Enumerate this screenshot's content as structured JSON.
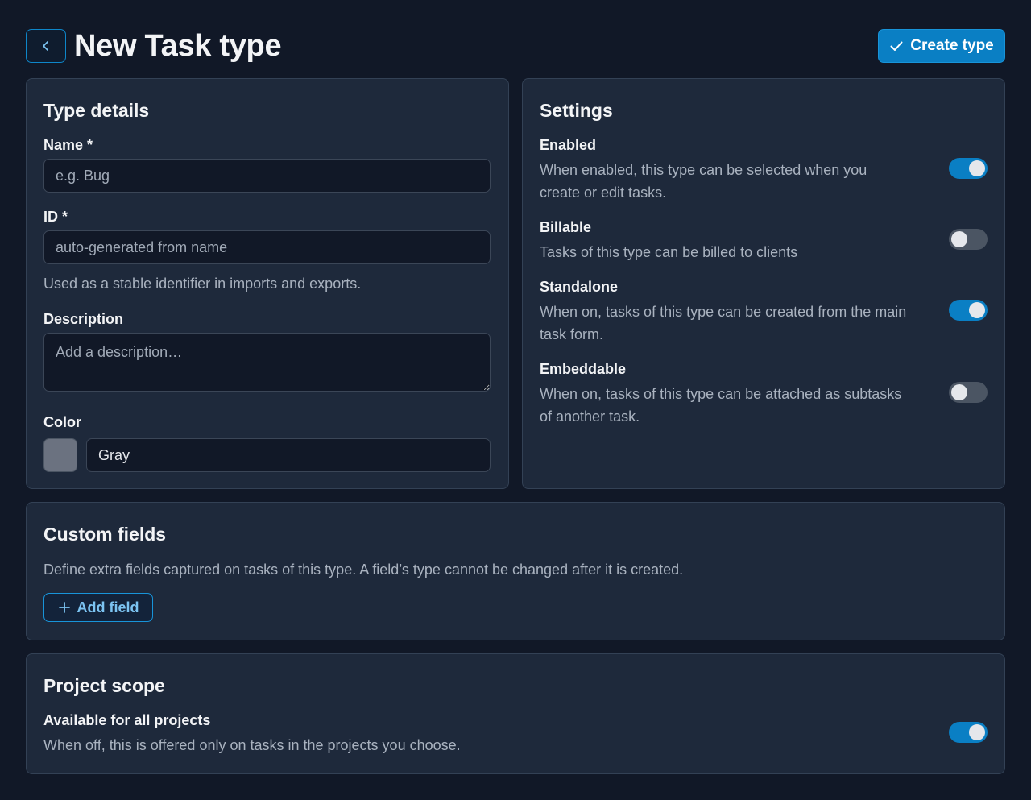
{
  "header": {
    "title": "New Task type",
    "create_label": "Create type"
  },
  "type_details": {
    "title": "Type details",
    "name_label": "Name *",
    "name_placeholder": "e.g. Bug",
    "id_label": "ID *",
    "id_placeholder": "auto-generated from name",
    "id_help": "Used as a stable identifier in imports and exports.",
    "description_label": "Description",
    "description_placeholder": "Add a description…",
    "color_label": "Color",
    "color_value": "Gray",
    "color_swatch": "#6b7280"
  },
  "settings": {
    "title": "Settings",
    "items": [
      {
        "label": "Enabled",
        "line1": "When enabled, this type can be selected when you",
        "line2": "create or edit tasks.",
        "on": true
      },
      {
        "label": "Billable",
        "line1": "Tasks of this type can be billed to clients",
        "line2": "",
        "on": false
      },
      {
        "label": "Standalone",
        "line1": "When on, tasks of this type can be created from the main",
        "line2": "task form.",
        "on": true
      },
      {
        "label": "Embeddable",
        "line1": "When on, tasks of this type can be attached as subtasks",
        "line2": "of another task.",
        "on": false
      }
    ]
  },
  "custom_fields": {
    "title": "Custom fields",
    "description": "Define extra fields captured on tasks of this type. A field’s type cannot be changed after it is created.",
    "add_label": "Add field"
  },
  "project_scope": {
    "title": "Project scope",
    "label": "Available for all projects",
    "description": "When off, this is offered only on tasks in the projects you choose.",
    "on": true
  },
  "colors": {
    "accent": "#0a7fc4",
    "background": "#111827",
    "card": "#1e293b"
  },
  "icons": {
    "back": "chevron-left-icon",
    "create": "check-icon",
    "add": "plus-icon"
  }
}
